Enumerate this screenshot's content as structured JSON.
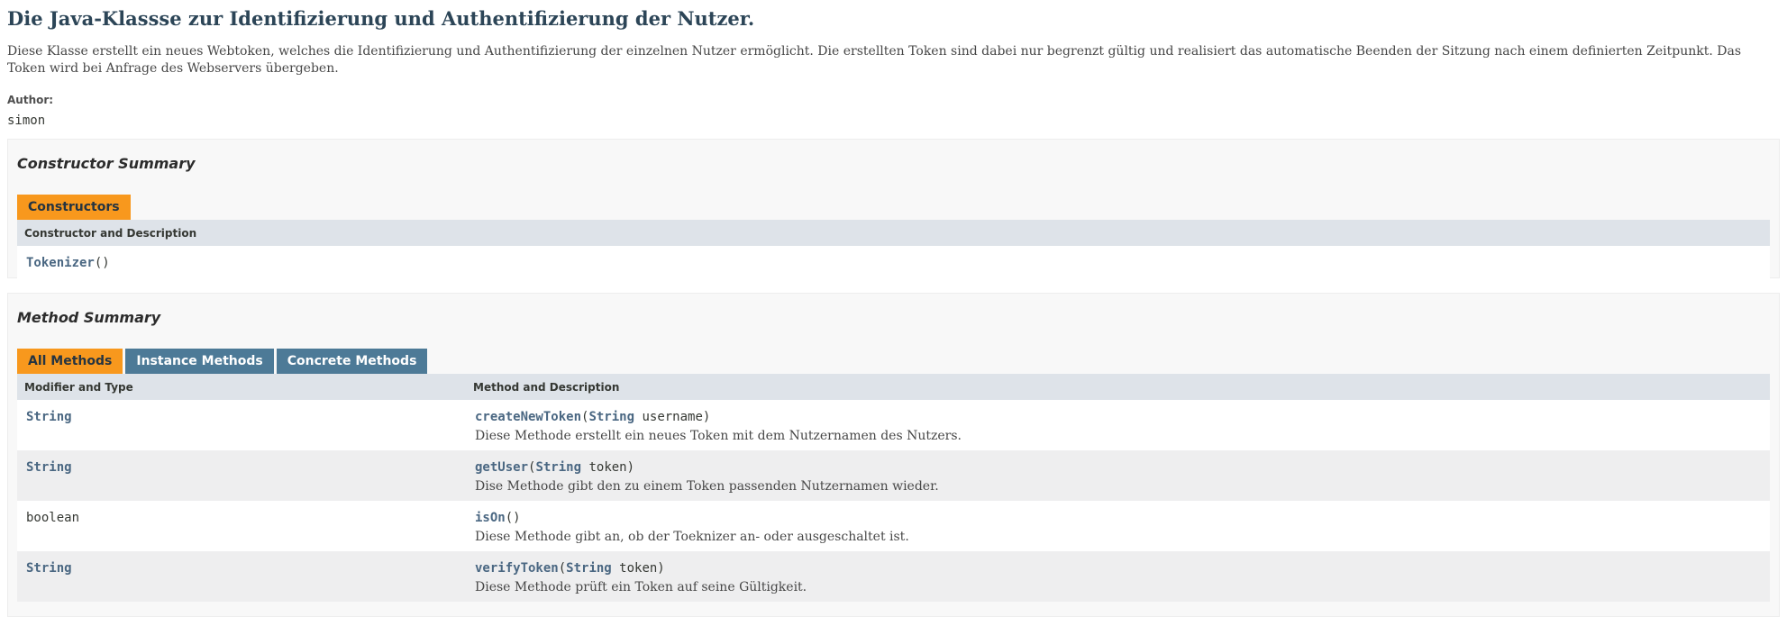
{
  "header": {
    "title": "Die Java-Klassse zur Identifizierung und Authentifizierung der Nutzer.",
    "description": "Diese Klasse erstellt ein neues Webtoken, welches die Identifizierung und Authentifizierung der einzelnen Nutzer ermöglicht. Die erstellten Token sind dabei nur begrenzt gültig und realisiert das automatische Beenden der Sitzung nach einem definierten Zeitpunkt. Das Token wird bei Anfrage des Webservers übergeben.",
    "author_label": "Author:",
    "author": "simon"
  },
  "constructor_summary": {
    "title": "Constructor Summary",
    "tab": "Constructors",
    "column": "Constructor and Description",
    "rows": [
      {
        "name": "Tokenizer",
        "params": "()"
      }
    ]
  },
  "method_summary": {
    "title": "Method Summary",
    "tabs": [
      "All Methods",
      "Instance Methods",
      "Concrete Methods"
    ],
    "columns": [
      "Modifier and Type",
      "Method and Description"
    ],
    "rows": [
      {
        "type": "String",
        "name": "createNewToken",
        "open": "(",
        "ptype": "String",
        "pname": " username)",
        "desc": "Diese Methode erstellt ein neues Token mit dem Nutzernamen des Nutzers."
      },
      {
        "type": "String",
        "name": "getUser",
        "open": "(",
        "ptype": "String",
        "pname": " token)",
        "desc": "Dise Methode gibt den zu einem Token passenden Nutzernamen wieder."
      },
      {
        "type": "boolean",
        "name": "isOn",
        "params": "()",
        "desc": "Diese Methode gibt an, ob der Toeknizer an- oder ausgeschaltet ist."
      },
      {
        "type": "String",
        "name": "verifyToken",
        "open": "(",
        "ptype": "String",
        "pname": " token)",
        "desc": "Diese Methode prüft ein Token auf seine Gültigkeit."
      }
    ]
  }
}
